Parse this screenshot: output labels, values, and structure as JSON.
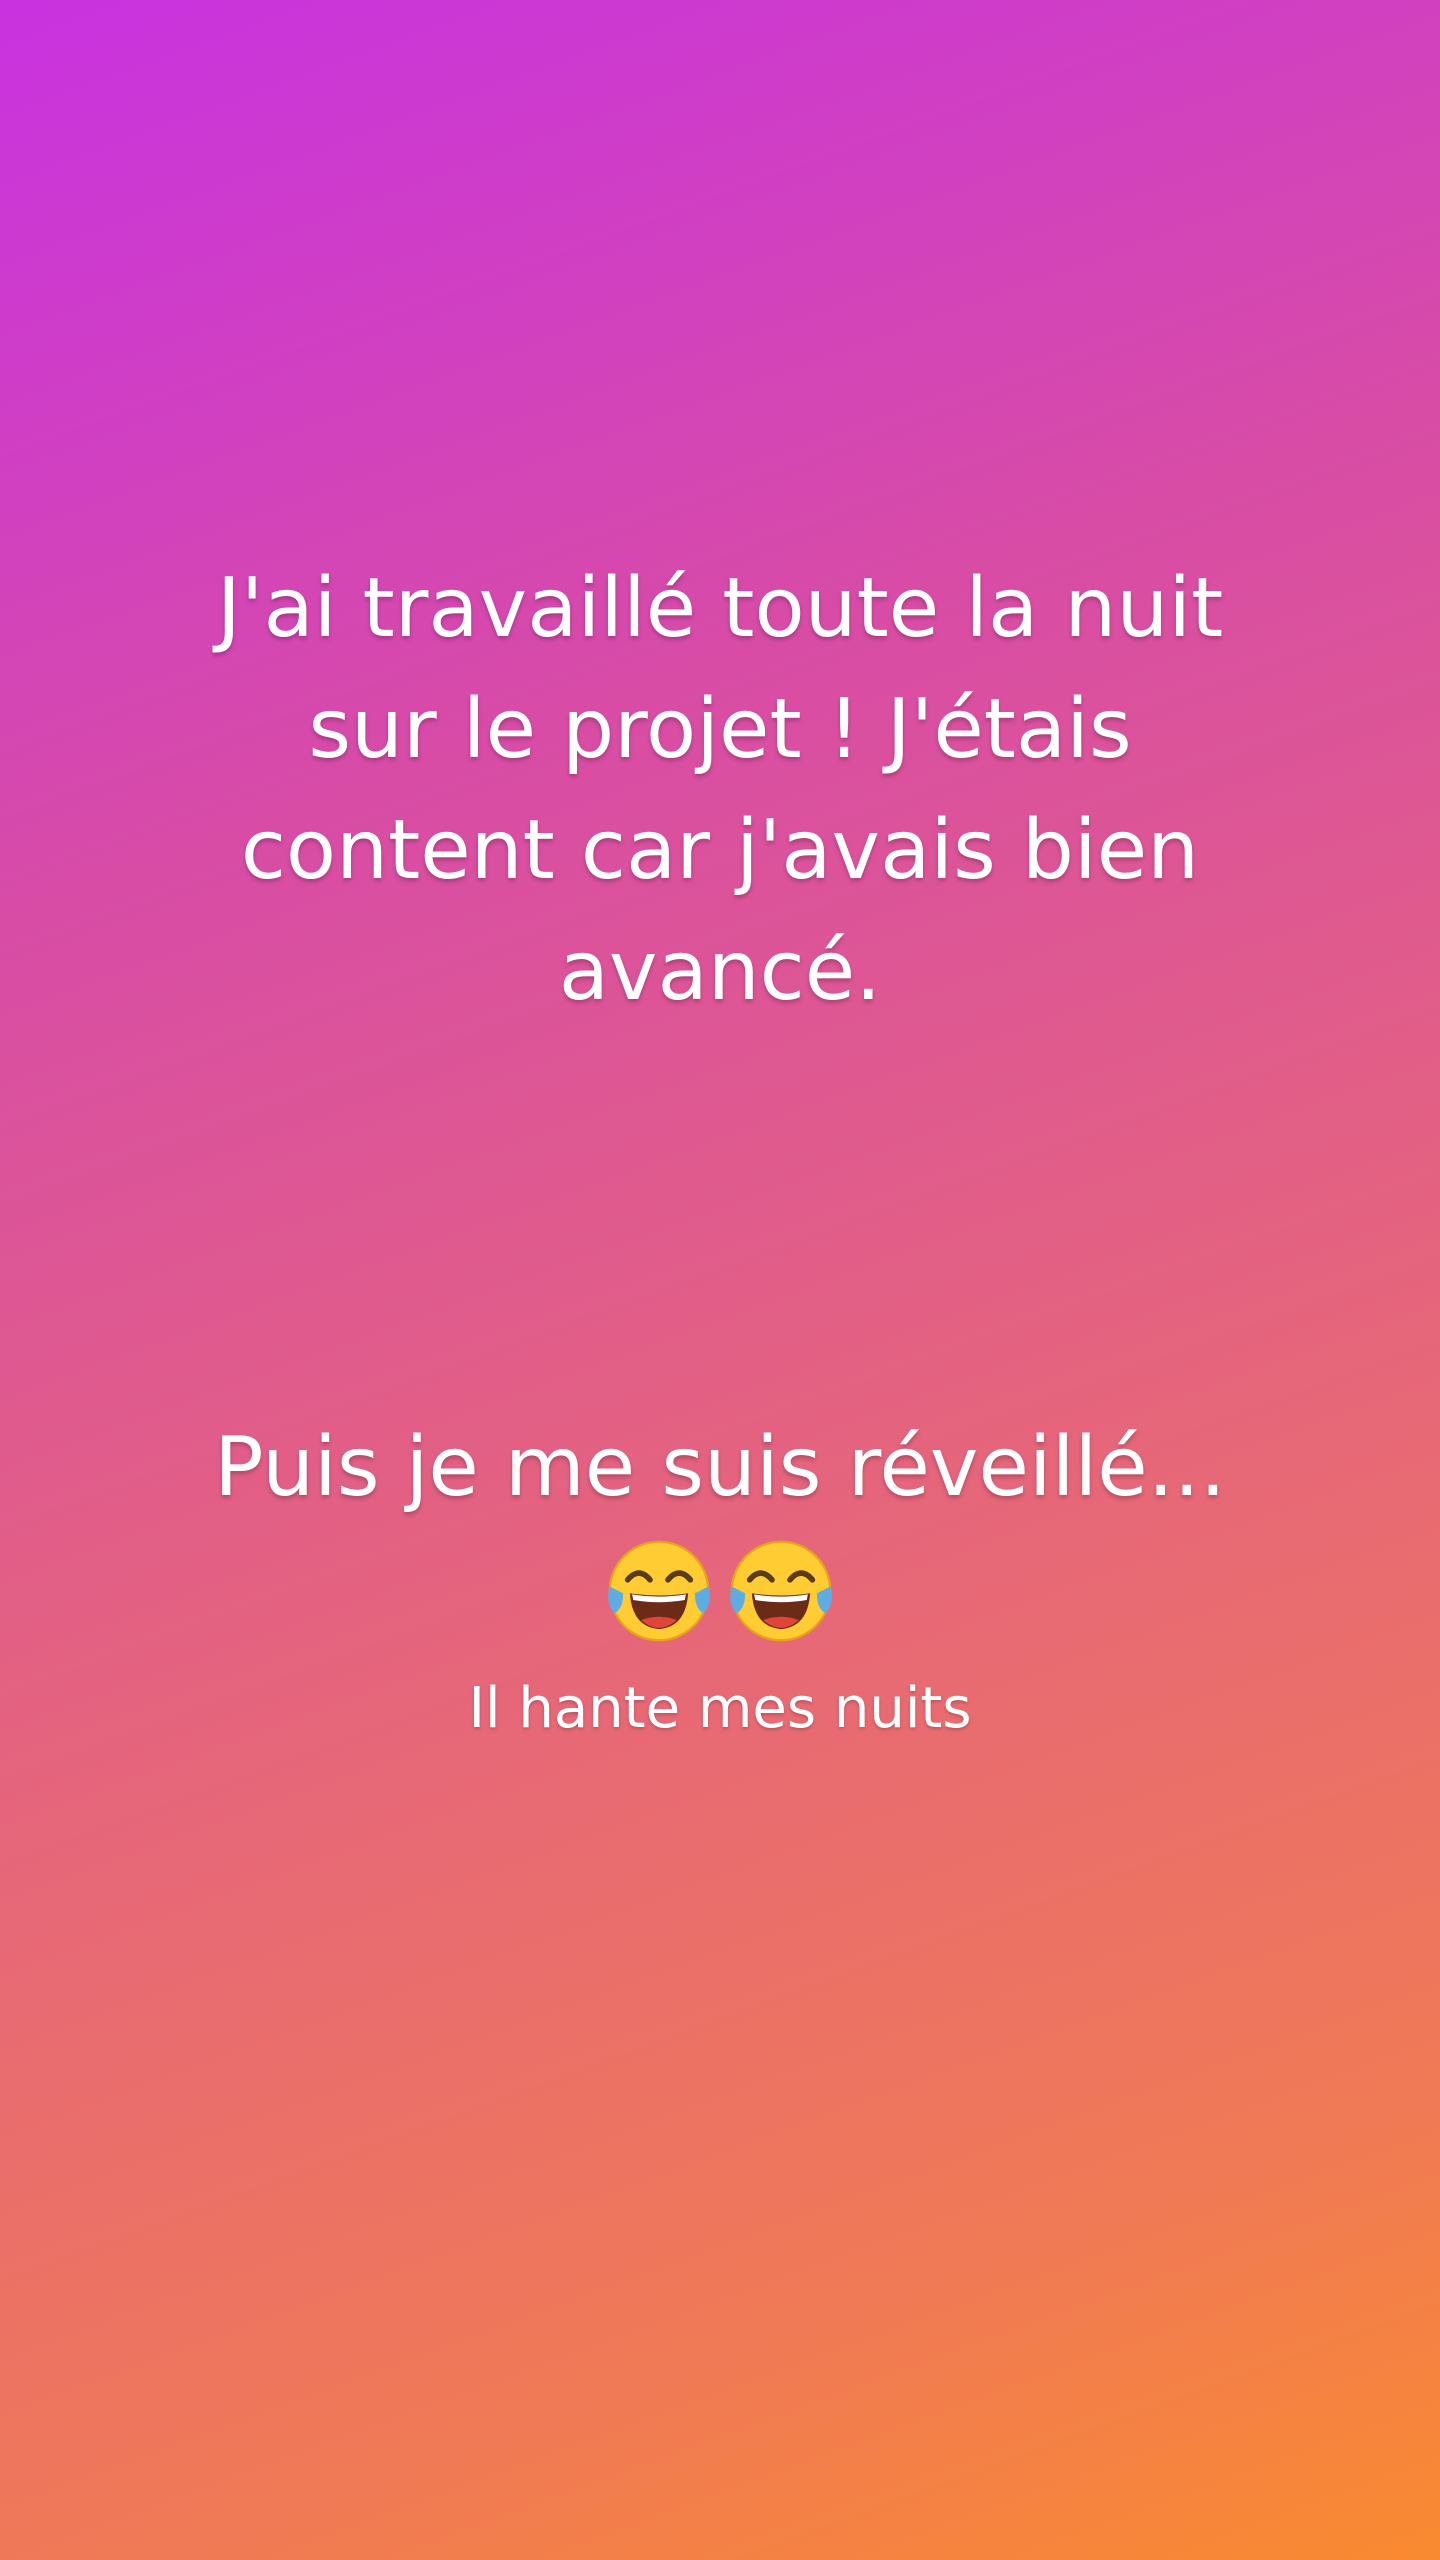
{
  "story": {
    "main_lines": [
      "J'ai travaillé toute la nuit",
      "sur le projet ! J'étais",
      "content car j'avais bien",
      "avancé."
    ],
    "second_line": "Puis je me suis réveillé...",
    "emojis": [
      "face-with-tears-of-joy-icon",
      "face-with-tears-of-joy-icon"
    ],
    "caption": "Il hante mes nuits",
    "colors": {
      "gradient_start": "#c832e0",
      "gradient_end": "#fa8a30",
      "text": "#ffffff"
    }
  }
}
